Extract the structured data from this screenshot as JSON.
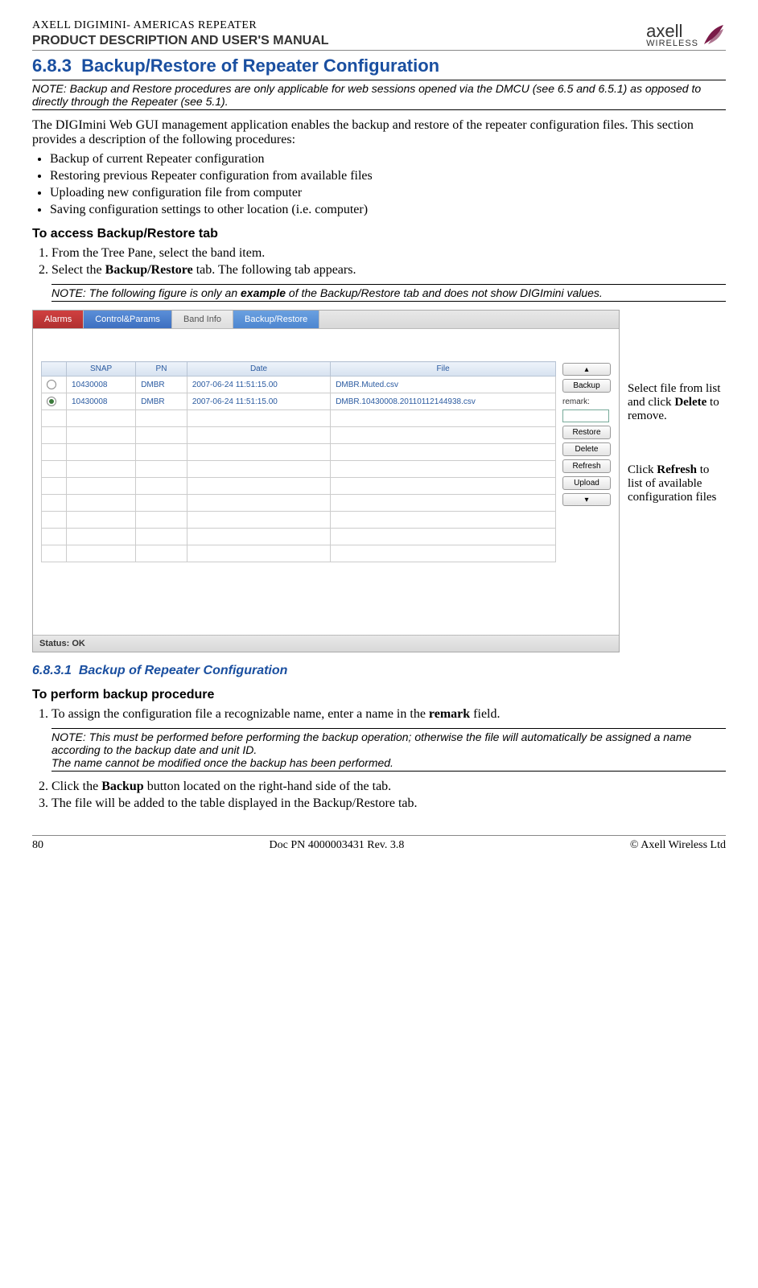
{
  "header": {
    "small": "AXELL DIGIMINI- AMERICAS REPEATER",
    "sub": "PRODUCT DESCRIPTION AND USER'S MANUAL",
    "logo_text": "axell",
    "logo_sub": "WIRELESS"
  },
  "section": {
    "num": "6.8.3",
    "title": "Backup/Restore of Repeater Configuration"
  },
  "note1": "NOTE: Backup and Restore procedures are only applicable for web sessions opened via the DMCU (see 6.5 and 6.5.1) as opposed to directly through the Repeater (see 5.1).",
  "intro": "The DIGImini Web GUI management application enables the backup and restore of the repeater configuration files. This section provides a description of the following procedures:",
  "bullets": [
    "Backup of current Repeater configuration",
    "Restoring previous Repeater configuration from available files",
    "Uploading new configuration file from computer",
    "Saving configuration settings to other location (i.e. computer)"
  ],
  "access_head": "To access Backup/Restore tab",
  "access_steps": {
    "s1": "From the Tree Pane, select the band item.",
    "s2_a": "Select the ",
    "s2_b": "Backup/Restore",
    "s2_c": " tab. The following tab appears."
  },
  "note2_a": "NOTE: The following figure is only an ",
  "note2_b": "example",
  "note2_c": " of the Backup/Restore tab and does not show DIGImini values.",
  "tabs": {
    "alarms": "Alarms",
    "control": "Control&Params",
    "band": "Band Info",
    "backup": "Backup/Restore"
  },
  "table": {
    "headers": {
      "snap": "SNAP",
      "pn": "PN",
      "date": "Date",
      "file": "File"
    },
    "rows": [
      {
        "snap": "10430008",
        "pn": "DMBR",
        "date": "2007-06-24 11:51:15.00",
        "file": "DMBR.Muted.csv",
        "sel": false
      },
      {
        "snap": "10430008",
        "pn": "DMBR",
        "date": "2007-06-24 11:51:15.00",
        "file": "DMBR.10430008.20110112144938.csv",
        "sel": true
      }
    ]
  },
  "buttons": {
    "backup": "Backup",
    "remark": "remark:",
    "restore": "Restore",
    "delete": "Delete",
    "refresh": "Refresh",
    "upload": "Upload"
  },
  "status": "Status: OK",
  "anno1_a": "Select file from list and click ",
  "anno1_b": "Delete",
  "anno1_c": " to remove.",
  "anno2_a": "Click ",
  "anno2_b": "Refresh",
  "anno2_c": " to list of available configuration files",
  "subsection": {
    "num": "6.8.3.1",
    "title": "Backup of Repeater Configuration"
  },
  "perform_head": "To perform backup procedure",
  "perform": {
    "s1_a": "To assign the configuration file a recognizable name, enter a name in the ",
    "s1_b": "remark",
    "s1_c": " field.",
    "s2_a": "Click the ",
    "s2_b": "Backup",
    "s2_c": " button located on the right-hand side of the tab.",
    "s3": "The file will be added to the table displayed in the Backup/Restore tab."
  },
  "note3": "NOTE: This must be performed before performing the backup operation; otherwise the file will automatically be assigned a name according to the backup date and unit ID.\nThe name cannot be modified once the backup has been performed.",
  "footer": {
    "page": "80",
    "doc": "Doc PN 4000003431 Rev. 3.8",
    "copy": "© Axell Wireless Ltd"
  }
}
